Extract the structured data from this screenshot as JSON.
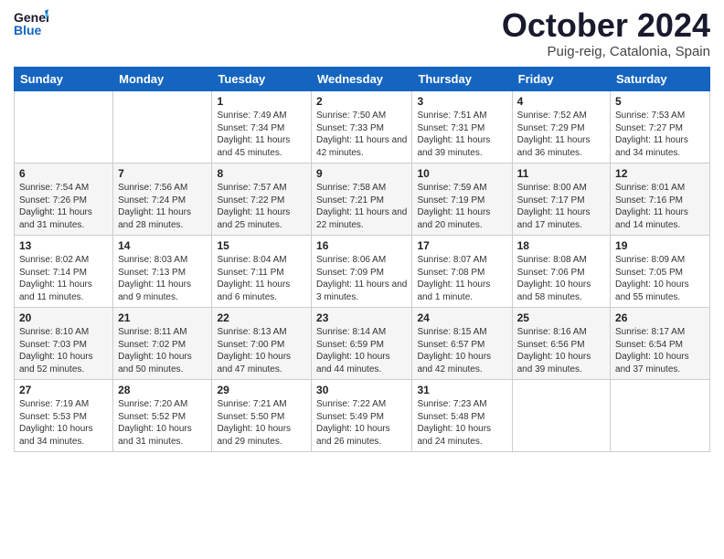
{
  "header": {
    "logo_general": "General",
    "logo_blue": "Blue",
    "month_title": "October 2024",
    "location": "Puig-reig, Catalonia, Spain"
  },
  "days_of_week": [
    "Sunday",
    "Monday",
    "Tuesday",
    "Wednesday",
    "Thursday",
    "Friday",
    "Saturday"
  ],
  "weeks": [
    [
      {
        "day": "",
        "info": ""
      },
      {
        "day": "",
        "info": ""
      },
      {
        "day": "1",
        "info": "Sunrise: 7:49 AM\nSunset: 7:34 PM\nDaylight: 11 hours and 45 minutes."
      },
      {
        "day": "2",
        "info": "Sunrise: 7:50 AM\nSunset: 7:33 PM\nDaylight: 11 hours and 42 minutes."
      },
      {
        "day": "3",
        "info": "Sunrise: 7:51 AM\nSunset: 7:31 PM\nDaylight: 11 hours and 39 minutes."
      },
      {
        "day": "4",
        "info": "Sunrise: 7:52 AM\nSunset: 7:29 PM\nDaylight: 11 hours and 36 minutes."
      },
      {
        "day": "5",
        "info": "Sunrise: 7:53 AM\nSunset: 7:27 PM\nDaylight: 11 hours and 34 minutes."
      }
    ],
    [
      {
        "day": "6",
        "info": "Sunrise: 7:54 AM\nSunset: 7:26 PM\nDaylight: 11 hours and 31 minutes."
      },
      {
        "day": "7",
        "info": "Sunrise: 7:56 AM\nSunset: 7:24 PM\nDaylight: 11 hours and 28 minutes."
      },
      {
        "day": "8",
        "info": "Sunrise: 7:57 AM\nSunset: 7:22 PM\nDaylight: 11 hours and 25 minutes."
      },
      {
        "day": "9",
        "info": "Sunrise: 7:58 AM\nSunset: 7:21 PM\nDaylight: 11 hours and 22 minutes."
      },
      {
        "day": "10",
        "info": "Sunrise: 7:59 AM\nSunset: 7:19 PM\nDaylight: 11 hours and 20 minutes."
      },
      {
        "day": "11",
        "info": "Sunrise: 8:00 AM\nSunset: 7:17 PM\nDaylight: 11 hours and 17 minutes."
      },
      {
        "day": "12",
        "info": "Sunrise: 8:01 AM\nSunset: 7:16 PM\nDaylight: 11 hours and 14 minutes."
      }
    ],
    [
      {
        "day": "13",
        "info": "Sunrise: 8:02 AM\nSunset: 7:14 PM\nDaylight: 11 hours and 11 minutes."
      },
      {
        "day": "14",
        "info": "Sunrise: 8:03 AM\nSunset: 7:13 PM\nDaylight: 11 hours and 9 minutes."
      },
      {
        "day": "15",
        "info": "Sunrise: 8:04 AM\nSunset: 7:11 PM\nDaylight: 11 hours and 6 minutes."
      },
      {
        "day": "16",
        "info": "Sunrise: 8:06 AM\nSunset: 7:09 PM\nDaylight: 11 hours and 3 minutes."
      },
      {
        "day": "17",
        "info": "Sunrise: 8:07 AM\nSunset: 7:08 PM\nDaylight: 11 hours and 1 minute."
      },
      {
        "day": "18",
        "info": "Sunrise: 8:08 AM\nSunset: 7:06 PM\nDaylight: 10 hours and 58 minutes."
      },
      {
        "day": "19",
        "info": "Sunrise: 8:09 AM\nSunset: 7:05 PM\nDaylight: 10 hours and 55 minutes."
      }
    ],
    [
      {
        "day": "20",
        "info": "Sunrise: 8:10 AM\nSunset: 7:03 PM\nDaylight: 10 hours and 52 minutes."
      },
      {
        "day": "21",
        "info": "Sunrise: 8:11 AM\nSunset: 7:02 PM\nDaylight: 10 hours and 50 minutes."
      },
      {
        "day": "22",
        "info": "Sunrise: 8:13 AM\nSunset: 7:00 PM\nDaylight: 10 hours and 47 minutes."
      },
      {
        "day": "23",
        "info": "Sunrise: 8:14 AM\nSunset: 6:59 PM\nDaylight: 10 hours and 44 minutes."
      },
      {
        "day": "24",
        "info": "Sunrise: 8:15 AM\nSunset: 6:57 PM\nDaylight: 10 hours and 42 minutes."
      },
      {
        "day": "25",
        "info": "Sunrise: 8:16 AM\nSunset: 6:56 PM\nDaylight: 10 hours and 39 minutes."
      },
      {
        "day": "26",
        "info": "Sunrise: 8:17 AM\nSunset: 6:54 PM\nDaylight: 10 hours and 37 minutes."
      }
    ],
    [
      {
        "day": "27",
        "info": "Sunrise: 7:19 AM\nSunset: 5:53 PM\nDaylight: 10 hours and 34 minutes."
      },
      {
        "day": "28",
        "info": "Sunrise: 7:20 AM\nSunset: 5:52 PM\nDaylight: 10 hours and 31 minutes."
      },
      {
        "day": "29",
        "info": "Sunrise: 7:21 AM\nSunset: 5:50 PM\nDaylight: 10 hours and 29 minutes."
      },
      {
        "day": "30",
        "info": "Sunrise: 7:22 AM\nSunset: 5:49 PM\nDaylight: 10 hours and 26 minutes."
      },
      {
        "day": "31",
        "info": "Sunrise: 7:23 AM\nSunset: 5:48 PM\nDaylight: 10 hours and 24 minutes."
      },
      {
        "day": "",
        "info": ""
      },
      {
        "day": "",
        "info": ""
      }
    ]
  ]
}
